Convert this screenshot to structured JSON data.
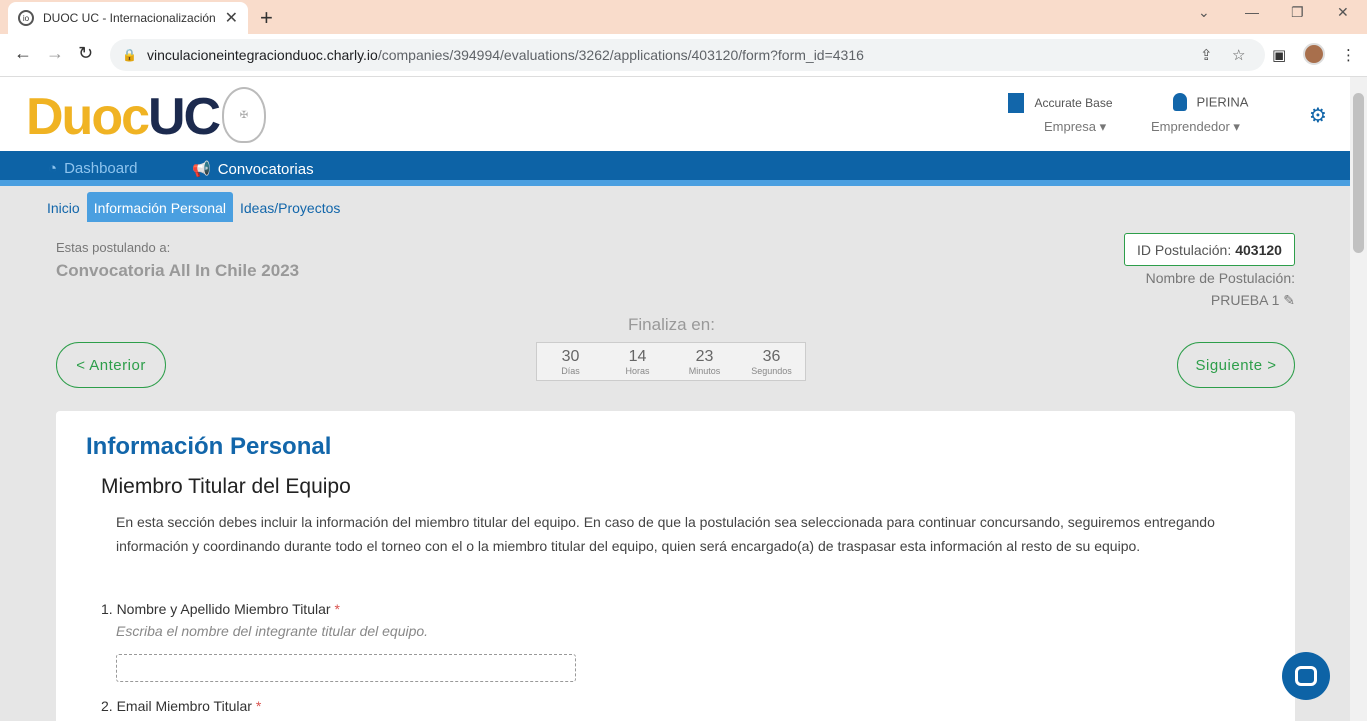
{
  "browser": {
    "tab_title": "DUOC UC - Internacionalización",
    "new_tab": "+",
    "url_host": "vinculacioneintegracionduoc.charly.io",
    "url_path": "/companies/394994/evaluations/3262/applications/403120/form?form_id=4316"
  },
  "header": {
    "logo_duoc": "Duoc",
    "logo_uc": "UC",
    "company_name": "Accurate Base",
    "company_role": "Empresa",
    "user_name": "PIERINA",
    "user_role": "Emprendedor"
  },
  "nav": {
    "dashboard": "Dashboard",
    "convocatorias": "Convocatorias"
  },
  "subnav": [
    "Inicio",
    "Información Personal",
    "Ideas/Proyectos"
  ],
  "application": {
    "applying_label": "Estas postulando a:",
    "convocatoria": "Convocatoria All In Chile 2023",
    "id_label": "ID Postulación:",
    "id_value": "403120",
    "name_label": "Nombre de Postulación:",
    "name_value": "PRUEBA 1"
  },
  "countdown": {
    "label": "Finaliza en:",
    "days": "30",
    "days_label": "Días",
    "hours": "14",
    "hours_label": "Horas",
    "minutes": "23",
    "minutes_label": "Minutos",
    "seconds": "36",
    "seconds_label": "Segundos"
  },
  "buttons": {
    "prev": "< Anterior",
    "next": "Siguiente >"
  },
  "form": {
    "title": "Información Personal",
    "section_title": "Miembro Titular del Equipo",
    "section_desc": "En esta sección debes incluir la información del miembro titular del equipo. En caso de que la postulación sea seleccionada para continuar concursando, seguiremos entregando información y coordinando durante todo el torneo con el o la miembro titular del equipo, quien será encargado(a) de traspasar esta información al resto de su equipo.",
    "q1_label": "1. Nombre y Apellido Miembro Titular",
    "q1_hint": "Escriba el nombre del integrante titular del equipo.",
    "q2_label": "2. Email Miembro Titular",
    "required_mark": "*"
  }
}
